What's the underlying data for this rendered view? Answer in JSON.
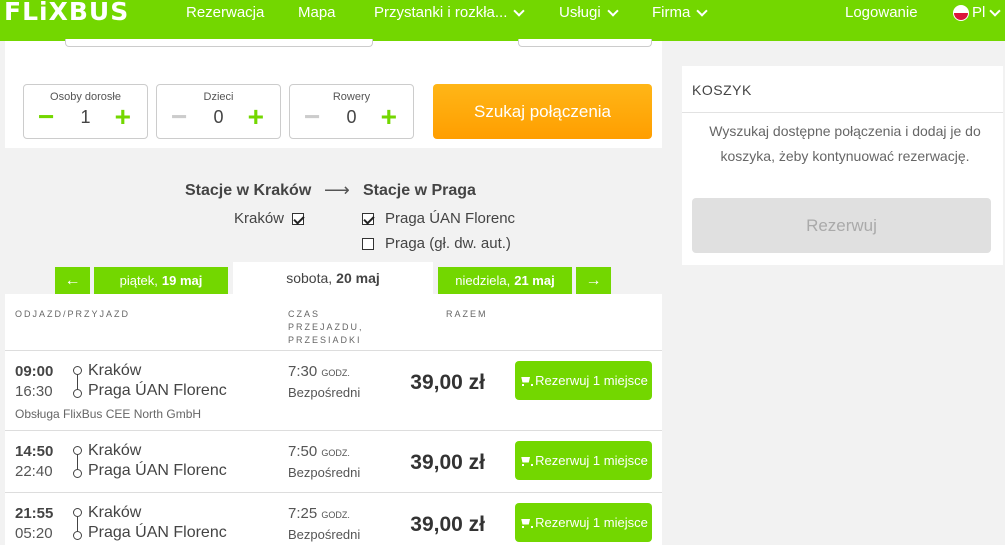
{
  "header": {
    "logo": "FLiXBUS",
    "nav": [
      {
        "label": "Rezerwacja",
        "dropdown": false
      },
      {
        "label": "Mapa",
        "dropdown": false
      },
      {
        "label": "Przystanki i rozkła...",
        "dropdown": true
      },
      {
        "label": "Usługi",
        "dropdown": true
      },
      {
        "label": "Firma",
        "dropdown": true
      }
    ],
    "login": "Logowanie",
    "lang": "Pl"
  },
  "passengers": {
    "adults": {
      "label": "Osoby dorosłe",
      "value": "1"
    },
    "children": {
      "label": "Dzieci",
      "value": "0"
    },
    "bikes": {
      "label": "Rowery",
      "value": "0"
    }
  },
  "search_button": "Szukaj połączenia",
  "stations": {
    "from_title": "Stacje w Kraków",
    "arrow": "⟶",
    "to_title": "Stacje w Praga",
    "from": [
      {
        "name": "Kraków",
        "checked": true
      }
    ],
    "to": [
      {
        "name": "Praga ÚAN Florenc",
        "checked": true
      },
      {
        "name": "Praga (gł. dw. aut.)",
        "checked": false
      }
    ]
  },
  "dates": {
    "prev_arrow": "←",
    "next_arrow": "→",
    "prev": {
      "day": "piątek,",
      "date": "19 maj"
    },
    "current": {
      "day": "sobota,",
      "date": "20 maj"
    },
    "next": {
      "day": "niedziela,",
      "date": "21 maj"
    }
  },
  "columns": {
    "departure": "ODJAZD/PRZYJAZD",
    "duration": [
      "CZAS",
      "PRZEJAZDU,",
      "PRZESIADKI"
    ],
    "total": "RAZEM"
  },
  "rides": [
    {
      "dep": "09:00",
      "arr": "16:30",
      "from": "Kraków",
      "to": "Praga ÚAN Florenc",
      "duration": "7:30",
      "unit": "GODZ.",
      "connection": "Bezpośredni",
      "price": "39,00 zł",
      "button": "Rezerwuj 1 miejsce",
      "operator": "Obsługa FlixBus CEE North GmbH"
    },
    {
      "dep": "14:50",
      "arr": "22:40",
      "from": "Kraków",
      "to": "Praga ÚAN Florenc",
      "duration": "7:50",
      "unit": "GODZ.",
      "connection": "Bezpośredni",
      "price": "39,00 zł",
      "button": "Rezerwuj 1 miejsce"
    },
    {
      "dep": "21:55",
      "arr": "05:20",
      "from": "Kraków",
      "to": "Praga ÚAN Florenc",
      "duration": "7:25",
      "unit": "GODZ.",
      "connection": "Bezpośredni",
      "price": "39,00 zł",
      "button": "Rezerwuj 1 miejsce"
    }
  ],
  "cart": {
    "title": "KOSZYK",
    "text": "Wyszukaj dostępne połączenia i dodaj je do koszyka, żeby kontynuować rezerwację.",
    "button": "Rezerwuj"
  },
  "colors": {
    "brand": "#73d700",
    "search": "#ffad00",
    "disabled": "#e0e0e0"
  }
}
